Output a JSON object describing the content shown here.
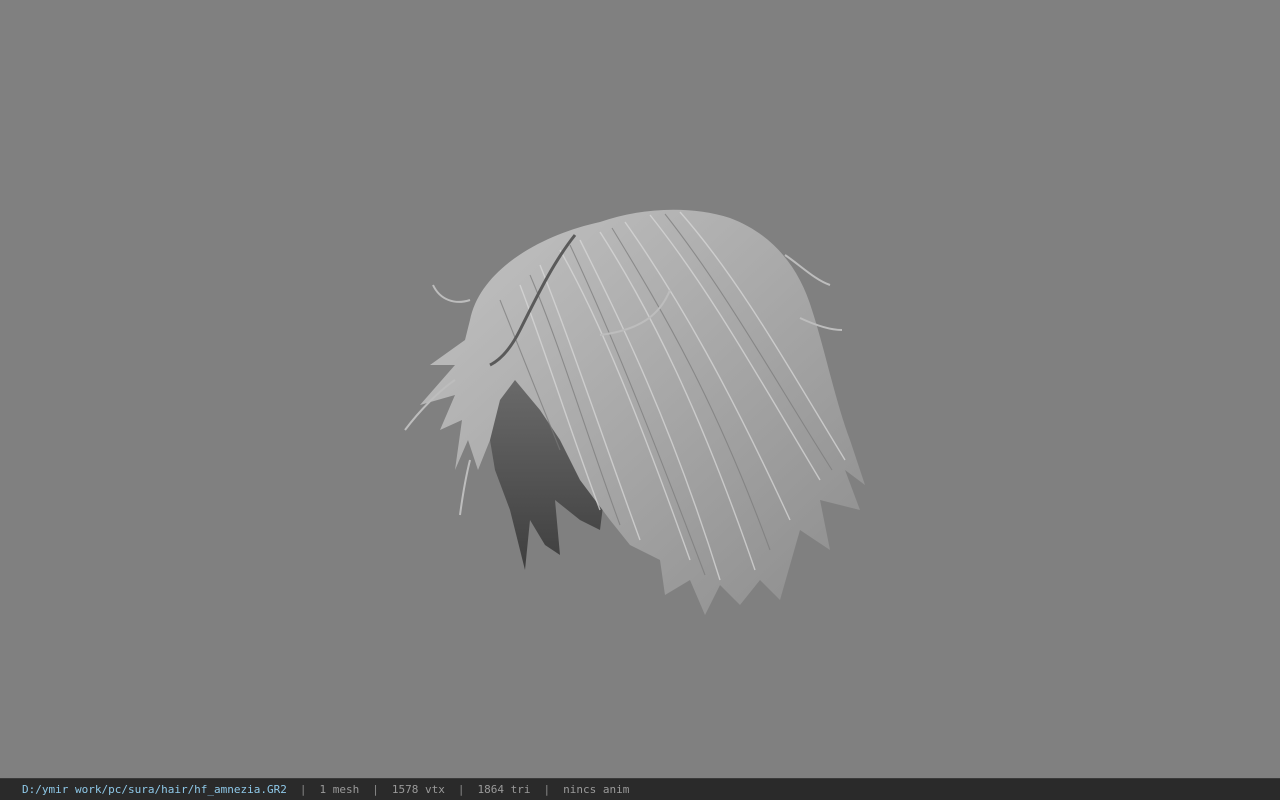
{
  "viewport": {
    "background_color": "#808080",
    "model_name": "hf_amnezia"
  },
  "status_bar": {
    "file_path": "D:/ymir work/pc/sura/hair/hf_amnezia.GR2",
    "separator": "|",
    "mesh_count": "1 mesh",
    "vertex_count": "1578 vtx",
    "triangle_count": "1864 tri",
    "anim_status": "nincs anim",
    "path_color": "#8ec8e8",
    "text_color": "#9a9a9a"
  }
}
